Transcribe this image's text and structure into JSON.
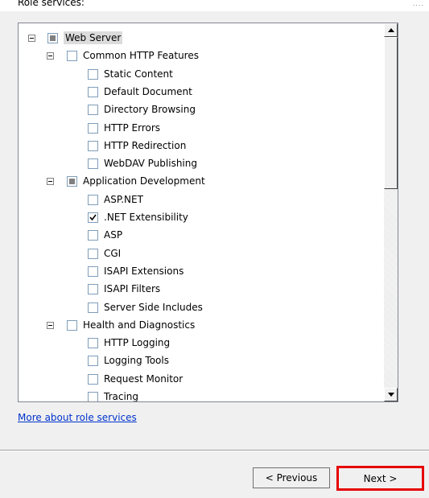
{
  "header": {
    "section_label": "Role services:",
    "corner_text": "...."
  },
  "tree": {
    "rows": [
      {
        "label": "Web Server",
        "level": 0,
        "expander": true,
        "state": "partial",
        "selected": true
      },
      {
        "label": "Common HTTP Features",
        "level": 1,
        "expander": true,
        "state": "unchecked"
      },
      {
        "label": "Static Content",
        "level": 2,
        "expander": false,
        "state": "unchecked"
      },
      {
        "label": "Default Document",
        "level": 2,
        "expander": false,
        "state": "unchecked"
      },
      {
        "label": "Directory Browsing",
        "level": 2,
        "expander": false,
        "state": "unchecked"
      },
      {
        "label": "HTTP Errors",
        "level": 2,
        "expander": false,
        "state": "unchecked"
      },
      {
        "label": "HTTP Redirection",
        "level": 2,
        "expander": false,
        "state": "unchecked"
      },
      {
        "label": "WebDAV Publishing",
        "level": 2,
        "expander": false,
        "state": "unchecked"
      },
      {
        "label": "Application Development",
        "level": 1,
        "expander": true,
        "state": "partial"
      },
      {
        "label": "ASP.NET",
        "level": 2,
        "expander": false,
        "state": "unchecked"
      },
      {
        "label": ".NET Extensibility",
        "level": 2,
        "expander": false,
        "state": "checked"
      },
      {
        "label": "ASP",
        "level": 2,
        "expander": false,
        "state": "unchecked"
      },
      {
        "label": "CGI",
        "level": 2,
        "expander": false,
        "state": "unchecked"
      },
      {
        "label": "ISAPI Extensions",
        "level": 2,
        "expander": false,
        "state": "unchecked"
      },
      {
        "label": "ISAPI Filters",
        "level": 2,
        "expander": false,
        "state": "unchecked"
      },
      {
        "label": "Server Side Includes",
        "level": 2,
        "expander": false,
        "state": "unchecked"
      },
      {
        "label": "Health and Diagnostics",
        "level": 1,
        "expander": true,
        "state": "unchecked"
      },
      {
        "label": "HTTP Logging",
        "level": 2,
        "expander": false,
        "state": "unchecked"
      },
      {
        "label": "Logging Tools",
        "level": 2,
        "expander": false,
        "state": "unchecked"
      },
      {
        "label": "Request Monitor",
        "level": 2,
        "expander": false,
        "state": "unchecked"
      },
      {
        "label": "Tracing",
        "level": 2,
        "expander": false,
        "state": "unchecked"
      }
    ]
  },
  "links": {
    "more_about": "More about role services"
  },
  "buttons": {
    "previous": "< Previous",
    "next": "Next >"
  },
  "colors": {
    "highlight_border": "#e60000",
    "link": "#0033cc"
  }
}
